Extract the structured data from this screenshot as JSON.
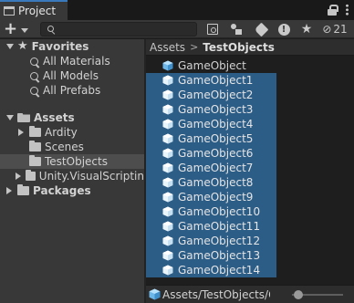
{
  "window": {
    "tab_title": "Project",
    "tab_icon": "folder-tab-icon"
  },
  "toolbar": {
    "create_icon": "plus-icon",
    "search_placeholder": "",
    "search_value": "",
    "hidden_packages_count": "21"
  },
  "sidebar": {
    "favorites_label": "Favorites",
    "favorites_items": [
      {
        "label": "All Materials",
        "icon": "search-icon"
      },
      {
        "label": "All Models",
        "icon": "search-icon"
      },
      {
        "label": "All Prefabs",
        "icon": "search-icon"
      }
    ],
    "assets_label": "Assets",
    "assets_children": [
      {
        "label": "Ardity",
        "expandable": true,
        "selected": false
      },
      {
        "label": "Scenes",
        "expandable": false,
        "selected": false
      },
      {
        "label": "TestObjects",
        "expandable": false,
        "selected": true
      },
      {
        "label": "Unity.VisualScriptin",
        "expandable": true,
        "selected": false
      }
    ],
    "packages_label": "Packages"
  },
  "breadcrumb": {
    "root": "Assets",
    "separator": ">",
    "current": "TestObjects"
  },
  "assets": {
    "items": [
      {
        "label": "GameObject",
        "selected": false
      },
      {
        "label": "GameObject1",
        "selected": true
      },
      {
        "label": "GameObject2",
        "selected": true
      },
      {
        "label": "GameObject3",
        "selected": true
      },
      {
        "label": "GameObject4",
        "selected": true
      },
      {
        "label": "GameObject5",
        "selected": true
      },
      {
        "label": "GameObject6",
        "selected": true
      },
      {
        "label": "GameObject7",
        "selected": true
      },
      {
        "label": "GameObject8",
        "selected": true
      },
      {
        "label": "GameObject9",
        "selected": true
      },
      {
        "label": "GameObject10",
        "selected": true
      },
      {
        "label": "GameObject11",
        "selected": true
      },
      {
        "label": "GameObject12",
        "selected": true
      },
      {
        "label": "GameObject13",
        "selected": true
      },
      {
        "label": "GameObject14",
        "selected": true
      }
    ]
  },
  "statusbar": {
    "path": "Assets/TestObjects/Gan",
    "icon_size_slider_value": 0
  },
  "colors": {
    "selection": "#2c5d87",
    "tab_accent": "#3a79bb",
    "panel_bg": "#383838",
    "list_bg": "#1e1e1e",
    "cube_icon": "#7ec2f0"
  }
}
